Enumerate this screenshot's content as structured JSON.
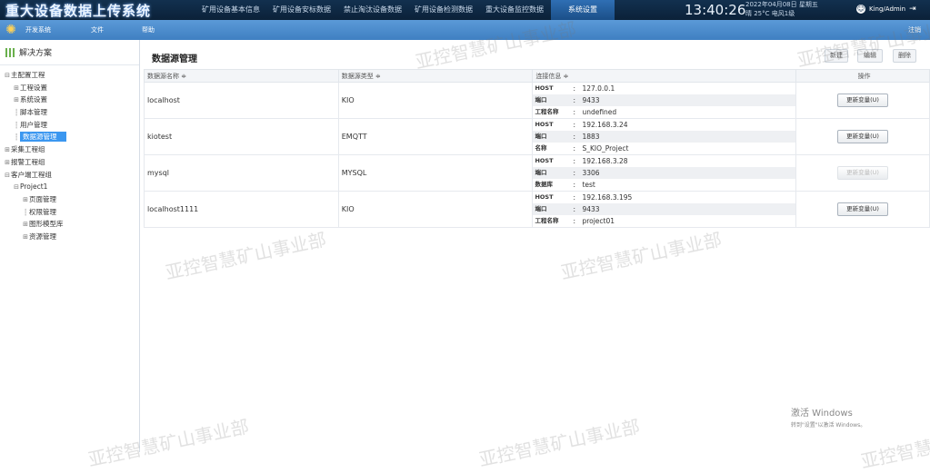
{
  "header": {
    "app_title": "重大设备数据上传系统",
    "nav": [
      "矿用设备基本信息",
      "矿用设备安标数据",
      "禁止淘汰设备数据",
      "矿用设备检测数据",
      "重大设备监控数据",
      "系统设置"
    ],
    "active_nav": "系统设置",
    "clock": "13:40:26",
    "date": "2022年04月08日  星期五",
    "weather": "晴   25°C     电风1级",
    "user": "King/Admin"
  },
  "menubar": {
    "items": [
      "开发系统",
      "文件",
      "帮助"
    ],
    "logout": "注销"
  },
  "sidebar": {
    "title": "解决方案",
    "tree": [
      {
        "label": "主配置工程",
        "toggle": "⊟",
        "indent": 0
      },
      {
        "label": "工程设置",
        "toggle": "⊞",
        "indent": 1
      },
      {
        "label": "系统设置",
        "toggle": "⊞",
        "indent": 1
      },
      {
        "label": "脚本管理",
        "toggle": "",
        "indent": 1
      },
      {
        "label": "用户管理",
        "toggle": "",
        "indent": 1
      },
      {
        "label": "数据源管理",
        "toggle": "",
        "indent": 1,
        "selected": true
      },
      {
        "label": "采集工程组",
        "toggle": "⊞",
        "indent": 0
      },
      {
        "label": "报警工程组",
        "toggle": "⊞",
        "indent": 0
      },
      {
        "label": "客户端工程组",
        "toggle": "⊟",
        "indent": 0
      },
      {
        "label": "Project1",
        "toggle": "⊟",
        "indent": 1
      },
      {
        "label": "页面管理",
        "toggle": "⊞",
        "indent": 2
      },
      {
        "label": "权限管理",
        "toggle": "",
        "indent": 2
      },
      {
        "label": "图形模型库",
        "toggle": "⊞",
        "indent": 2
      },
      {
        "label": "资源管理",
        "toggle": "⊞",
        "indent": 2
      }
    ]
  },
  "main": {
    "title": "数据源管理",
    "buttons": {
      "add": "新建",
      "edit": "编辑",
      "delete": "删除"
    },
    "columns": [
      "数据源名称 ≑",
      "数据源类型 ≑",
      "连接信息 ≑",
      "操作"
    ],
    "rows": [
      {
        "name": "localhost",
        "type": "KIO",
        "info": [
          [
            "HOST",
            "127.0.0.1"
          ],
          [
            "端口",
            "9433"
          ],
          [
            "工程名称",
            "undefined"
          ]
        ],
        "action": "更新变量(U)",
        "enabled": true
      },
      {
        "name": "kiotest",
        "type": "EMQTT",
        "info": [
          [
            "HOST",
            "192.168.3.24"
          ],
          [
            "端口",
            "1883"
          ],
          [
            "名称",
            "S_KIO_Project"
          ]
        ],
        "action": "更新变量(U)",
        "enabled": true
      },
      {
        "name": "mysql",
        "type": "MYSQL",
        "info": [
          [
            "HOST",
            "192.168.3.28"
          ],
          [
            "端口",
            "3306"
          ],
          [
            "数据库",
            "test"
          ]
        ],
        "action": "更新变量(U)",
        "enabled": false
      },
      {
        "name": "localhost1111",
        "type": "KIO",
        "info": [
          [
            "HOST",
            "192.168.3.195"
          ],
          [
            "端口",
            "9433"
          ],
          [
            "工程名称",
            "project01"
          ]
        ],
        "action": "更新变量(U)",
        "enabled": true
      }
    ]
  },
  "watermark": "亚控智慧矿山事业部",
  "activation": {
    "title": "激活 Windows",
    "hint": "转到\"设置\"以激活 Windows。"
  }
}
